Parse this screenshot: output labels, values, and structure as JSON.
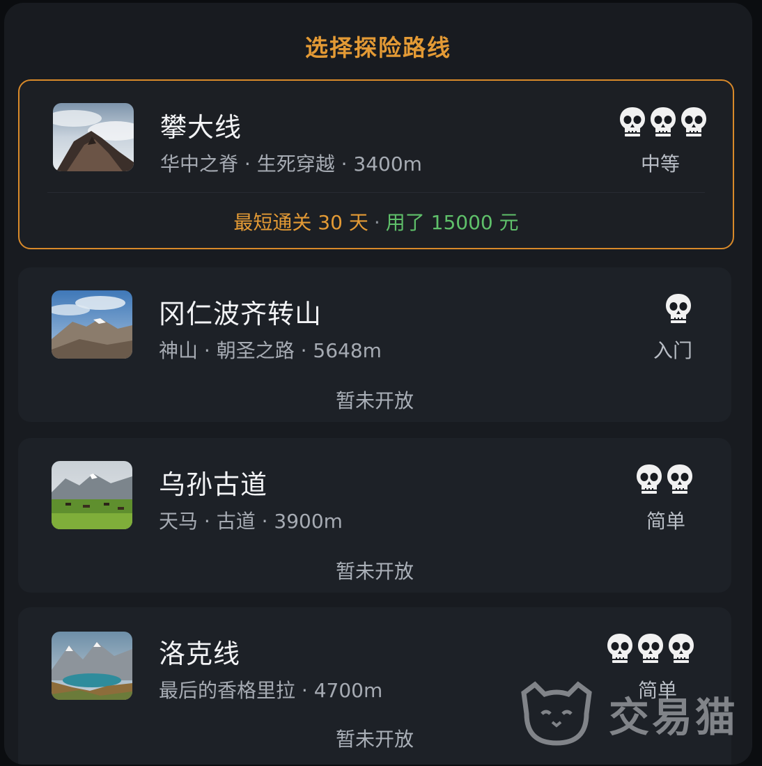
{
  "header": {
    "title": "选择探险路线"
  },
  "routes": [
    {
      "name": "攀大线",
      "meta": "华中之脊 · 生死穿越 · 3400m",
      "skull_count": 3,
      "difficulty": "中等",
      "selected": true,
      "footer": {
        "best": "最短通关 30 天",
        "separator": "·",
        "spent": "用了 15000 元"
      },
      "thumb_icon": "mountain-cloud-sea-photo"
    },
    {
      "name": "冈仁波齐转山",
      "meta": "神山 · 朝圣之路 · 5648m",
      "skull_count": 1,
      "difficulty": "入门",
      "selected": false,
      "status": "暂未开放",
      "thumb_icon": "holy-mountain-photo"
    },
    {
      "name": "乌孙古道",
      "meta": "天马 · 古道 · 3900m",
      "skull_count": 2,
      "difficulty": "简单",
      "selected": false,
      "status": "暂未开放",
      "thumb_icon": "grassland-horses-photo"
    },
    {
      "name": "洛克线",
      "meta": "最后的香格里拉 · 4700m",
      "skull_count": 3,
      "difficulty": "简单",
      "selected": false,
      "status": "暂未开放",
      "thumb_icon": "alpine-lake-photo"
    }
  ],
  "watermark": {
    "text": "交易猫",
    "icon": "cat-logo-icon"
  },
  "colors": {
    "accent": "#e39a35",
    "green": "#5fc06a",
    "card_bg": "#1d2127"
  }
}
